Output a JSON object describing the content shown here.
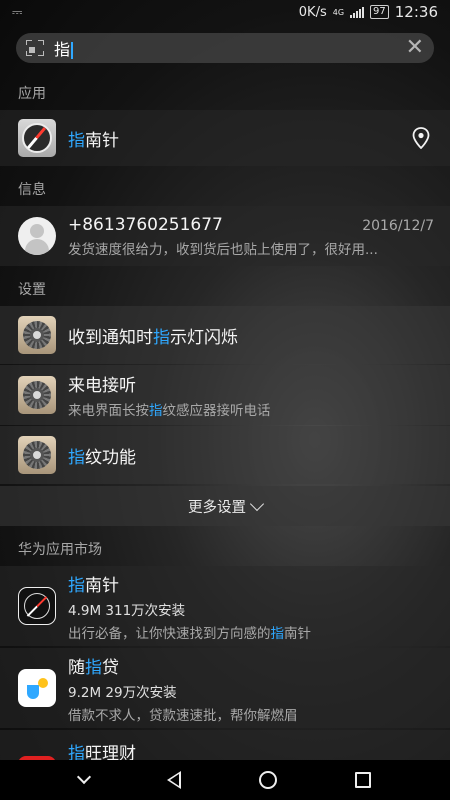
{
  "status_bar": {
    "speed": "0K/s",
    "network": "4G",
    "battery": "97",
    "time": "12:36"
  },
  "search": {
    "query": "指"
  },
  "sections": {
    "apps": "应用",
    "messages": "信息",
    "settings": "设置",
    "market": "华为应用市场"
  },
  "app_result": {
    "title_hl": "指",
    "title_rest": "南针"
  },
  "message_result": {
    "sender": "+8613760251677",
    "date": "2016/12/7",
    "preview": "发货速度很给力，收到货后也贴上使用了，很好用..."
  },
  "settings_results": [
    {
      "pre": "收到通知时",
      "hl": "指",
      "post": "示灯闪烁"
    },
    {
      "title": "来电接听",
      "sub_pre": "来电界面长按",
      "sub_hl": "指",
      "sub_post": "纹感应器接听电话"
    },
    {
      "pre": "",
      "hl": "指",
      "post": "纹功能"
    }
  ],
  "more_settings": "更多设置",
  "market_results": [
    {
      "title_hl": "指",
      "title_rest": "南针",
      "meta": "4.9M 311万次安装",
      "desc_pre": "出行必备，让你快速找到方向感的",
      "desc_hl": "指",
      "desc_post": "南针"
    },
    {
      "title_pre": "随",
      "title_hl": "指",
      "title_rest": "贷",
      "meta": "9.2M 29万次安装",
      "desc": "借款不求人，贷款速速批，帮你解燃眉"
    },
    {
      "title_hl": "指",
      "title_rest": "旺理财"
    }
  ],
  "icons": {
    "notification": "notification-icon",
    "scan": "scan-icon",
    "clear": "clear-icon",
    "location": "location-icon",
    "compass": "compass-icon",
    "avatar": "avatar-icon",
    "settings": "gear-icon"
  },
  "colors": {
    "highlight": "#2fa8ff"
  }
}
